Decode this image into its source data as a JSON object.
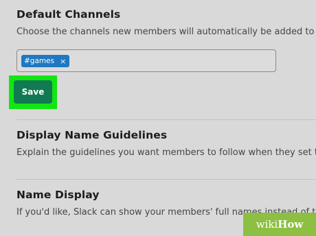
{
  "default_channels": {
    "heading": "Default Channels",
    "description": "Choose the channels new members will automatically be added to (i",
    "tags": [
      "#games"
    ],
    "tag_remove": "×",
    "save_label": "Save"
  },
  "display_name_guidelines": {
    "heading": "Display Name Guidelines",
    "description": "Explain the guidelines you want members to follow when they set th"
  },
  "name_display": {
    "heading": "Name Display",
    "description": "If you'd like, Slack can show your members' full names instead of the"
  },
  "watermark": {
    "part1": "wiki",
    "part2": "How"
  },
  "colors": {
    "background": "#d9d9d9",
    "tag": "#1f78c1",
    "save_button": "#117a52",
    "highlight": "#12e612",
    "watermark": "#8cbf42"
  }
}
